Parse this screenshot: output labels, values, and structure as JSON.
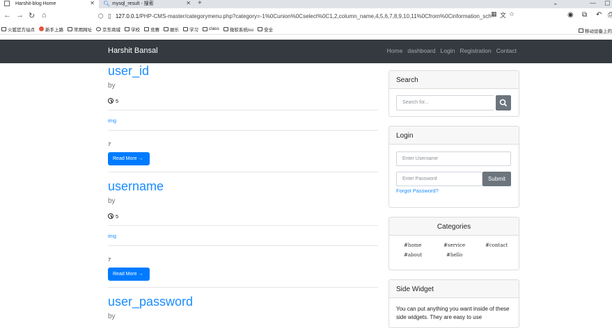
{
  "browser": {
    "tabs": [
      {
        "title": "Harshit-blog Home"
      },
      {
        "title": "mysql_result - 搜索"
      }
    ],
    "url_host": "127.0.0.1",
    "url_path": "/PHP-CMS-master/categorymenu.php?category=-1%0Cunion%0Cselect%0C1,2,column_name,4,5,6,7,8,9,10,11%0Cfrom%0Cinformation_sch",
    "bookmarks": [
      {
        "label": "火狐官方站点",
        "icon": "folder-icon"
      },
      {
        "label": "新手上路",
        "icon": "firefox-icon"
      },
      {
        "label": "常用网址",
        "icon": "folder-icon"
      },
      {
        "label": "京东商城",
        "icon": "globe-icon"
      },
      {
        "label": "学校",
        "icon": "folder-icon"
      },
      {
        "label": "竞赛",
        "icon": "folder-icon"
      },
      {
        "label": "娱乐",
        "icon": "folder-icon"
      },
      {
        "label": "学习",
        "icon": "folder-icon"
      },
      {
        "label": "class",
        "icon": "folder-icon"
      },
      {
        "label": "微软系统iso",
        "icon": "folder-icon"
      },
      {
        "label": "安全",
        "icon": "folder-icon"
      }
    ],
    "mobile_bookmarks": "移动设备上的"
  },
  "navbar": {
    "brand": "Harshit Bansal",
    "links": [
      "Home",
      "dashboard",
      "Login",
      "Registration",
      "Contact"
    ]
  },
  "posts": [
    {
      "title": "user_id",
      "by": "by",
      "time": "5",
      "image_link": "img",
      "views": "7",
      "read_more": "Read More →"
    },
    {
      "title": "username",
      "by": "by",
      "time": "5",
      "image_link": "img",
      "views": "7",
      "read_more": "Read More →"
    },
    {
      "title": "user_password",
      "by": "by"
    }
  ],
  "sidebar": {
    "search": {
      "heading": "Search",
      "placeholder": "Search for..."
    },
    "login": {
      "heading": "Login",
      "username_placeholder": "Enter Username",
      "password_placeholder": "Enter Password",
      "submit": "Submit",
      "forgot": "Forgot Password?"
    },
    "categories": {
      "heading": "Categories",
      "items": [
        "#home",
        "#service",
        "#contact",
        "#about",
        "#hello"
      ]
    },
    "widget": {
      "heading": "Side Widget",
      "text": "You can put anything you want inside of these side widgets. They are easy to use"
    }
  },
  "colors": {
    "navbar": "#343a40",
    "link": "#1a8cff",
    "primary_button": "#007bff",
    "secondary_button": "#6c757d"
  }
}
